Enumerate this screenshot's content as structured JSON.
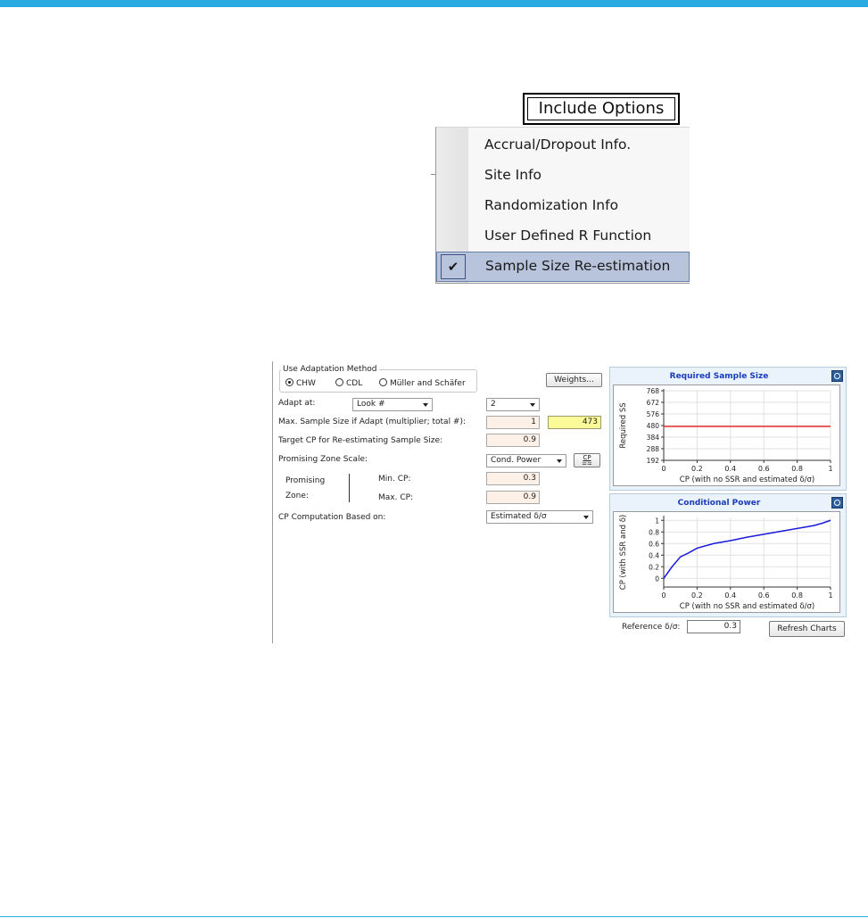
{
  "include_options": {
    "button_label": "Include Options",
    "items": [
      {
        "label": "Accrual/Dropout Info.",
        "checked": false
      },
      {
        "label": "Site Info",
        "checked": false
      },
      {
        "label": "Randomization Info",
        "checked": false
      },
      {
        "label": "User Defined R Function",
        "checked": false
      },
      {
        "label": "Sample Size Re-estimation",
        "checked": true
      }
    ],
    "check_glyph": "✔"
  },
  "adaptation": {
    "group_title": "Use Adaptation Method",
    "methods": [
      {
        "label": "CHW",
        "selected": true
      },
      {
        "label": "CDL",
        "selected": false
      },
      {
        "label": "Müller and Schäfer",
        "selected": false
      }
    ],
    "weights_button": "Weights...",
    "adapt_at_label": "Adapt at:",
    "adapt_at_value": "Look #",
    "adapt_at_look": "2",
    "max_ss_label": "Max. Sample Size if Adapt (multiplier; total #):",
    "max_ss_multiplier": "1",
    "max_ss_total": "473",
    "target_cp_label": "Target CP for Re-estimating Sample Size:",
    "target_cp_value": "0.9",
    "pz_scale_label": "Promising Zone Scale:",
    "pz_scale_value": "Cond. Power",
    "cp_button_top": "CP",
    "cp_button_bottom": "==",
    "zone_label_1": "Promising",
    "zone_label_2": "Zone:",
    "min_cp_label": "Min. CP:",
    "min_cp_value": "0.3",
    "max_cp_label": "Max. CP:",
    "max_cp_value": "0.9",
    "cp_based_label": "CP Computation Based on:",
    "cp_based_value": "Estimated δ/σ",
    "reference_label": "Reference δ/σ:",
    "reference_value": "0.3",
    "refresh_button": "Refresh Charts"
  },
  "chart_data": [
    {
      "type": "line",
      "title": "Required Sample Size",
      "xlabel": "CP (with no SSR and estimated δ/σ)",
      "ylabel": "Required SS",
      "xlim": [
        0,
        1
      ],
      "ylim": [
        192,
        768
      ],
      "xticks": [
        "0",
        "0.2",
        "0.4",
        "0.6",
        "0.8",
        "1"
      ],
      "yticks": [
        "192",
        "288",
        "384",
        "480",
        "576",
        "672",
        "768"
      ],
      "grid": true,
      "series": [
        {
          "color": "#e8322a",
          "x": [
            0,
            1
          ],
          "y": [
            473,
            473
          ]
        }
      ]
    },
    {
      "type": "line",
      "title": "Conditional Power",
      "xlabel": "CP (with no SSR and estimated δ/σ)",
      "ylabel": "CP (with SSR and δ)",
      "xlim": [
        0,
        1
      ],
      "ylim": [
        -0.15,
        1.05
      ],
      "xticks": [
        "0",
        "0.2",
        "0.4",
        "0.6",
        "0.8",
        "1"
      ],
      "yticks": [
        "0",
        "0.2",
        "0.4",
        "0.6",
        "0.8",
        "1"
      ],
      "grid": true,
      "series": [
        {
          "color": "#1a1adc",
          "x": [
            0,
            0.05,
            0.1,
            0.15,
            0.2,
            0.3,
            0.4,
            0.5,
            0.6,
            0.7,
            0.8,
            0.9,
            0.95,
            1
          ],
          "y": [
            0.0,
            0.2,
            0.37,
            0.44,
            0.52,
            0.6,
            0.65,
            0.71,
            0.76,
            0.81,
            0.86,
            0.91,
            0.95,
            1.0
          ]
        }
      ]
    }
  ]
}
